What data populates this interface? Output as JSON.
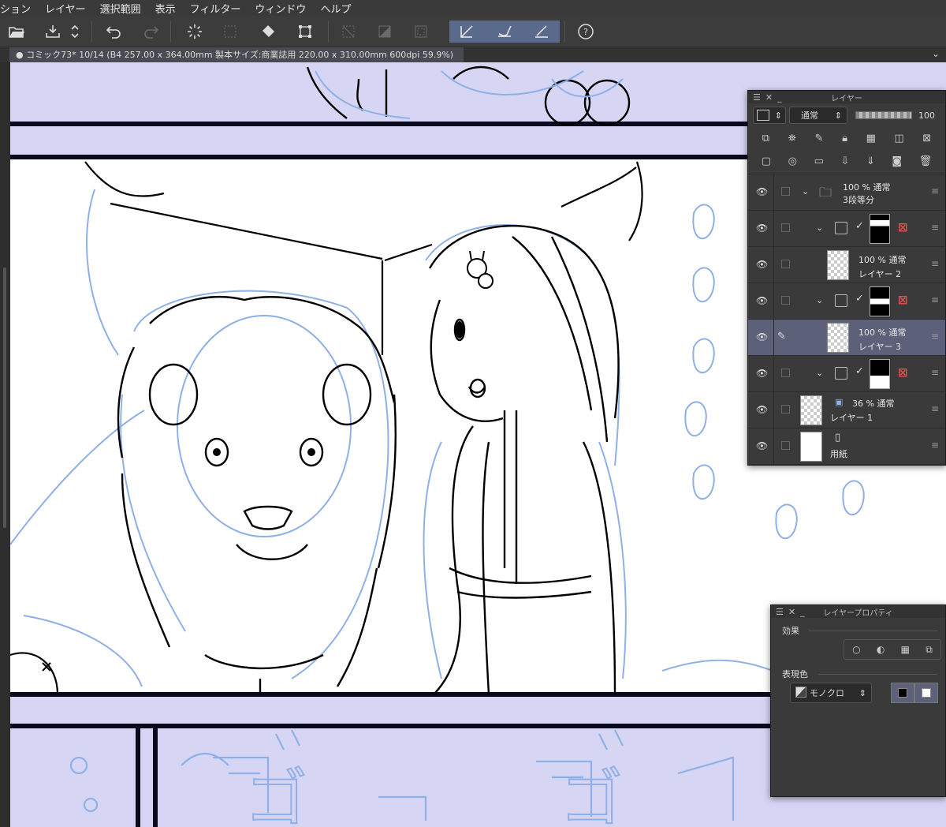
{
  "menu": [
    "ション",
    "レイヤー",
    "選択範囲",
    "表示",
    "フィルター",
    "ウィンドウ",
    "ヘルプ"
  ],
  "toolbar": {
    "open_icon": "folder-open-icon",
    "save_icon": "save-icon",
    "undo_icon": "undo-icon",
    "redo_icon": "redo-icon",
    "help_label": "?"
  },
  "document": {
    "tab_title": "● コミック73* 10/14 (B4 257.00 x 364.00mm 製本サイズ:商業誌用 220.00 x 310.00mm 600dpi 59.9%)"
  },
  "layer_panel": {
    "title": "レイヤー",
    "blend_mode": "通常",
    "opacity": "100",
    "layers": [
      {
        "type": "folder",
        "opacity_mode": "100 % 通常",
        "name": "3段等分"
      },
      {
        "type": "frame",
        "mask": "top"
      },
      {
        "type": "raster",
        "opacity_mode": "100 % 通常",
        "name": "レイヤー 2"
      },
      {
        "type": "frame",
        "mask": "middle"
      },
      {
        "type": "raster",
        "opacity_mode": "100 % 通常",
        "name": "レイヤー 3",
        "selected": true
      },
      {
        "type": "frame",
        "mask": "bottom"
      },
      {
        "type": "raster",
        "opacity_mode": "36 % 通常",
        "name": "レイヤー 1"
      },
      {
        "type": "paper",
        "name": "用紙"
      }
    ]
  },
  "property_panel": {
    "title": "レイヤープロパティ",
    "effect_label": "効果",
    "color_label": "表現色",
    "color_mode": "モノクロ"
  },
  "canvas_text": {
    "sfx_1": "ゴ",
    "sfx_2": "ゴ"
  },
  "colors": {
    "panel_bg": "#3a3a3a",
    "selected_layer": "#5c6079",
    "canvas_blue": "#d6d6f4",
    "sketch_blue": "#8fb0e6"
  }
}
